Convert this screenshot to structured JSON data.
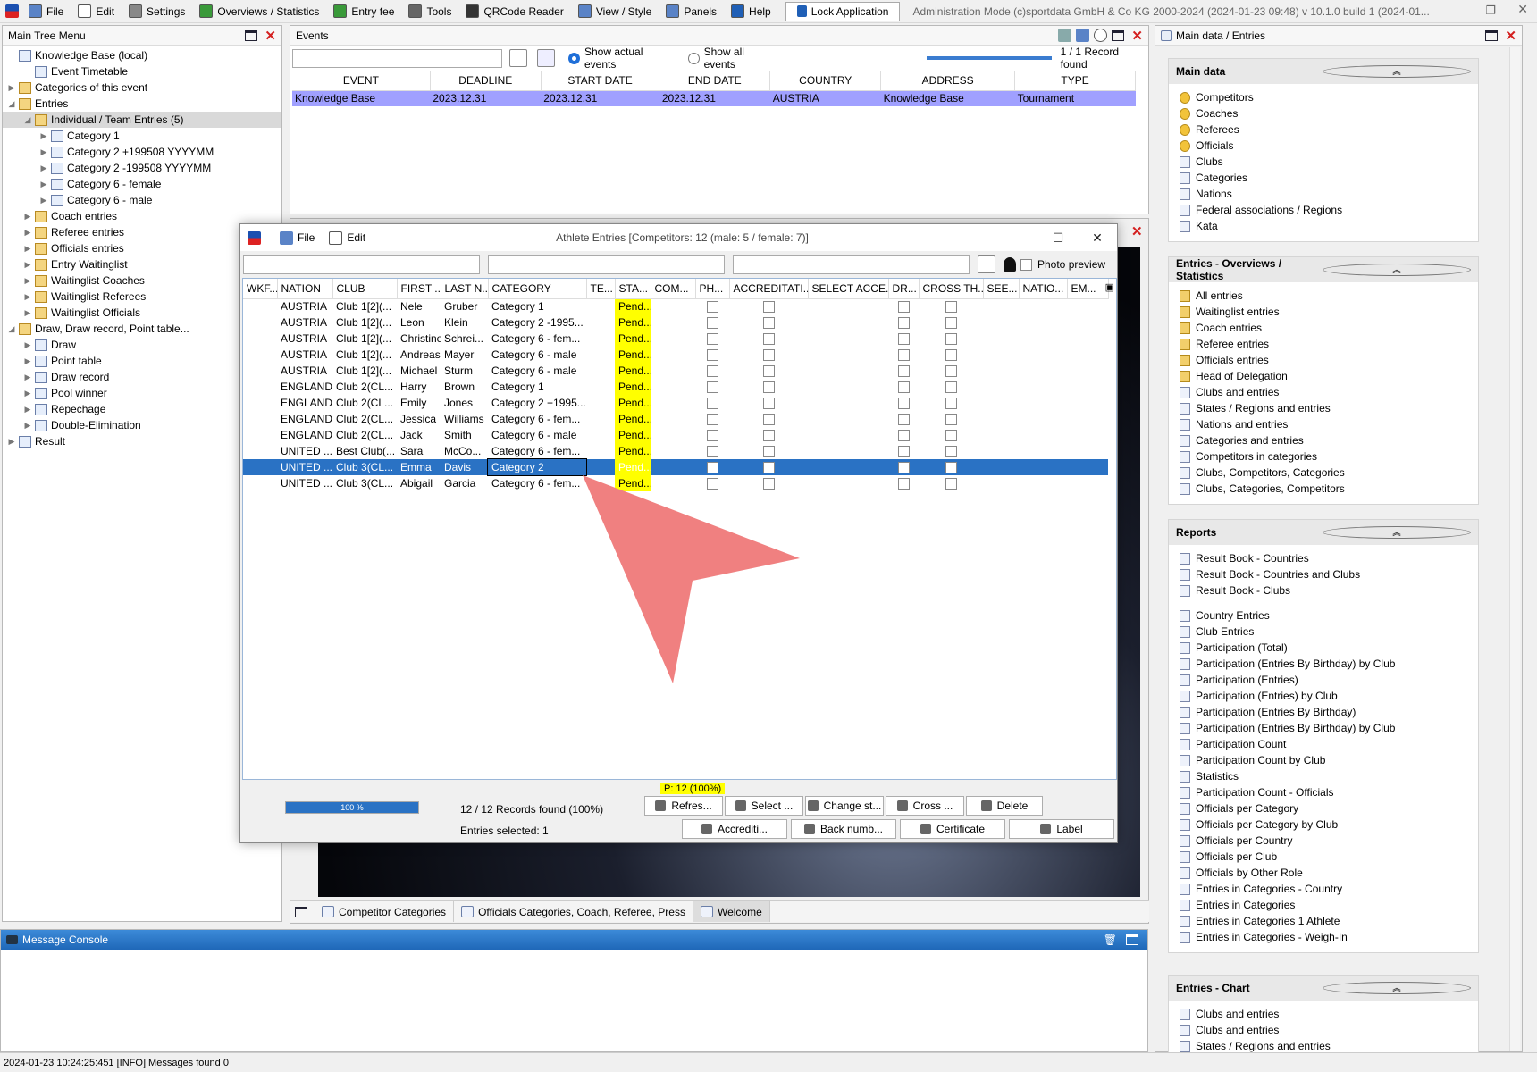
{
  "menubar": {
    "items": [
      "File",
      "Edit",
      "Settings",
      "Overviews / Statistics",
      "Entry fee",
      "Tools",
      "QRCode Reader",
      "View / Style",
      "Panels",
      "Help"
    ],
    "lock": "Lock Application",
    "admin": "Administration Mode (c)sportdata GmbH & Co KG 2000-2024 (2024-01-23 09:48)  v 10.1.0 build 1 (2024-01..."
  },
  "tree": {
    "title": "Main Tree Menu",
    "items": [
      {
        "label": "Knowledge Base (local)",
        "level": 0,
        "arrow": ""
      },
      {
        "label": "Event Timetable",
        "level": 1,
        "arrow": ""
      },
      {
        "label": "Categories of this event",
        "level": 0,
        "arrow": "▶"
      },
      {
        "label": "Entries",
        "level": 0,
        "arrow": "◢"
      },
      {
        "label": "Individual / Team Entries (5)",
        "level": 1,
        "arrow": "◢",
        "selected": true
      },
      {
        "label": "Category 1",
        "level": 2,
        "arrow": "▶"
      },
      {
        "label": "Category 2 +199508 YYYYMM",
        "level": 2,
        "arrow": "▶"
      },
      {
        "label": "Category 2 -199508 YYYYMM",
        "level": 2,
        "arrow": "▶"
      },
      {
        "label": "Category 6 - female",
        "level": 2,
        "arrow": "▶"
      },
      {
        "label": "Category 6 - male",
        "level": 2,
        "arrow": "▶"
      },
      {
        "label": "Coach entries",
        "level": 1,
        "arrow": "▶"
      },
      {
        "label": "Referee entries",
        "level": 1,
        "arrow": "▶"
      },
      {
        "label": "Officials entries",
        "level": 1,
        "arrow": "▶"
      },
      {
        "label": "Entry Waitinglist",
        "level": 1,
        "arrow": "▶"
      },
      {
        "label": "Waitinglist Coaches",
        "level": 1,
        "arrow": "▶"
      },
      {
        "label": "Waitinglist Referees",
        "level": 1,
        "arrow": "▶"
      },
      {
        "label": "Waitinglist Officials",
        "level": 1,
        "arrow": "▶"
      },
      {
        "label": "Draw, Draw record, Point table...",
        "level": 0,
        "arrow": "◢"
      },
      {
        "label": "Draw",
        "level": 1,
        "arrow": "▶"
      },
      {
        "label": "Point table",
        "level": 1,
        "arrow": "▶"
      },
      {
        "label": "Draw record",
        "level": 1,
        "arrow": "▶"
      },
      {
        "label": "Pool winner",
        "level": 1,
        "arrow": "▶"
      },
      {
        "label": "Repechage",
        "level": 1,
        "arrow": "▶"
      },
      {
        "label": "Double-Elimination",
        "level": 1,
        "arrow": "▶"
      },
      {
        "label": "Result",
        "level": 0,
        "arrow": "▶"
      }
    ]
  },
  "events": {
    "title": "Events",
    "show_actual": "Show actual events",
    "show_all": "Show all events",
    "record_found": "1 / 1 Record found",
    "columns": [
      "EVENT",
      "DEADLINE",
      "START DATE",
      "END DATE",
      "COUNTRY",
      "ADDRESS",
      "TYPE"
    ],
    "row": [
      "Knowledge Base",
      "2023.12.31",
      "2023.12.31",
      "2023.12.31",
      "AUSTRIA",
      "Knowledge Base",
      "Tournament"
    ]
  },
  "tabs": [
    "Competitor Categories",
    "Officials Categories, Coach, Referee, Press",
    "Welcome"
  ],
  "dialog": {
    "title": "Athlete Entries [Competitors: 12 (male: 5 / female: 7)]",
    "menu_file": "File",
    "menu_edit": "Edit",
    "photo_preview": "Photo preview",
    "columns": [
      "WKF...",
      "NATION",
      "CLUB",
      "FIRST ...",
      "LAST N...",
      "CATEGORY",
      "TE...",
      "STA...",
      "COM...",
      "PH...",
      "ACCREDITATI...",
      "SELECT ACCE...",
      "DR...",
      "CROSS TH...",
      "SEE...",
      "NATIO...",
      "EM..."
    ],
    "rows": [
      [
        "AUSTRIA",
        "Club 1[2](...",
        "Nele",
        "Gruber",
        "Category 1",
        "Pend..."
      ],
      [
        "AUSTRIA",
        "Club 1[2](...",
        "Leon",
        "Klein",
        "Category 2 -1995...",
        "Pend..."
      ],
      [
        "AUSTRIA",
        "Club 1[2](...",
        "Christine",
        "Schrei...",
        "Category 6 - fem...",
        "Pend..."
      ],
      [
        "AUSTRIA",
        "Club 1[2](...",
        "Andreas",
        "Mayer",
        "Category 6 - male",
        "Pend..."
      ],
      [
        "AUSTRIA",
        "Club 1[2](...",
        "Michael",
        "Sturm",
        "Category 6 - male",
        "Pend..."
      ],
      [
        "ENGLAND",
        "Club 2(CL...",
        "Harry",
        "Brown",
        "Category 1",
        "Pend..."
      ],
      [
        "ENGLAND",
        "Club 2(CL...",
        "Emily",
        "Jones",
        "Category 2 +1995...",
        "Pend..."
      ],
      [
        "ENGLAND",
        "Club 2(CL...",
        "Jessica",
        "Williams",
        "Category 6 - fem...",
        "Pend..."
      ],
      [
        "ENGLAND",
        "Club 2(CL...",
        "Jack",
        "Smith",
        "Category 6 - male",
        "Pend..."
      ],
      [
        "UNITED ...",
        "Best Club(...",
        "Sara",
        "McCo...",
        "Category 6 - fem...",
        "Pend..."
      ],
      [
        "UNITED ...",
        "Club 3(CL...",
        "Emma",
        "Davis",
        "Category 2",
        "Pend..."
      ],
      [
        "UNITED ...",
        "Club 3(CL...",
        "Abigail",
        "Garcia",
        "Category 6 - fem...",
        "Pend..."
      ]
    ],
    "selected_row": 10,
    "pending_summary": "P: 12 (100%)",
    "progress_label": "100 %",
    "progress": 1.0,
    "records_found": "12 / 12 Records found (100%)",
    "entries_selected": "Entries selected: 1",
    "buttons_row1": [
      "Refres...",
      "Select ...",
      "Change st...",
      "Cross ...",
      "Delete"
    ],
    "buttons_row2": [
      "Accrediti...",
      "Back numb...",
      "Certificate",
      "Label"
    ]
  },
  "right": {
    "title": "Main data / Entries",
    "sections": [
      {
        "title": "Main data",
        "items": [
          "Competitors",
          "Coaches",
          "Referees",
          "Officials",
          "Clubs",
          "Categories",
          "Nations",
          "Federal associations / Regions",
          "Kata"
        ]
      },
      {
        "title": "Entries - Overviews / Statistics",
        "items": [
          "All entries",
          "Waitinglist entries",
          "Coach entries",
          "Referee entries",
          "Officials entries",
          "Head of Delegation",
          "Clubs and entries",
          "States / Regions and entries",
          "Nations and entries",
          "Categories and entries",
          "Competitors in categories",
          "Clubs, Competitors, Categories",
          "Clubs, Categories, Competitors"
        ]
      },
      {
        "title": "Reports",
        "items": [
          "Result Book - Countries",
          "Result Book - Countries and Clubs",
          "Result Book - Clubs",
          "",
          "Country Entries",
          "Club Entries",
          "Participation (Total)",
          "Participation (Entries By Birthday) by Club",
          "Participation (Entries)",
          "Participation (Entries) by Club",
          "Participation (Entries By Birthday)",
          "Participation (Entries By Birthday) by Club",
          "Participation Count",
          "Participation Count by Club",
          "Statistics",
          "Participation Count - Officials",
          "Officials per Category",
          "Officials per Category by Club",
          "Officials per Country",
          "Officials per Club",
          "Officials by Other Role",
          "Entries in Categories - Country",
          "Entries in Categories",
          "Entries in Categories 1 Athlete",
          "Entries in Categories - Weigh-In"
        ]
      },
      {
        "title": "Entries - Chart",
        "items": [
          "Clubs and entries",
          "Clubs and entries",
          "States / Regions and entries"
        ]
      }
    ]
  },
  "console": {
    "title": "Message Console"
  },
  "status": "2024-01-23 10:24:25:451 [INFO] Messages found 0"
}
